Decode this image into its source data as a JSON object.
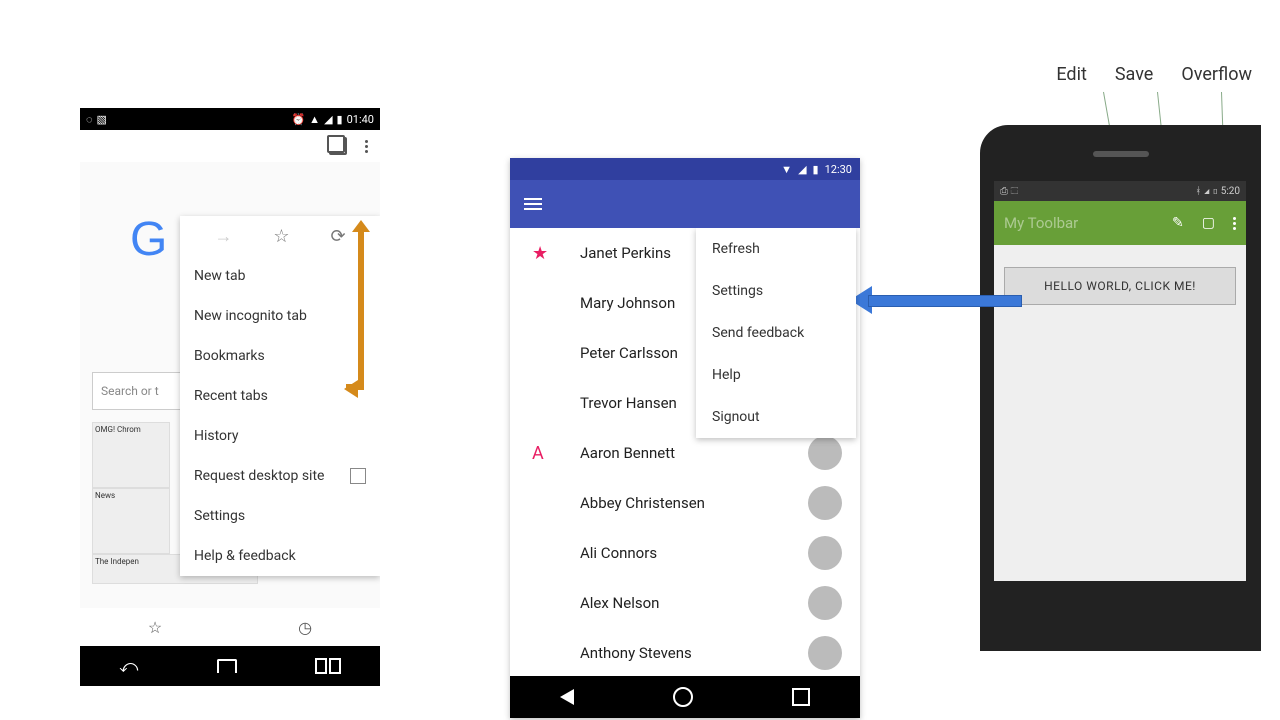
{
  "phone1": {
    "status_time": "01:40",
    "search_placeholder": "Search or t",
    "thumbs": [
      "OMG! Chrom",
      "News",
      "The Indepen"
    ],
    "menu": {
      "icons": [
        "→",
        "☆",
        "⟳"
      ],
      "items": [
        "New tab",
        "New incognito tab",
        "Bookmarks",
        "Recent tabs",
        "History",
        "Request desktop site",
        "Settings",
        "Help & feedback"
      ]
    }
  },
  "phone2": {
    "status_time": "12:30",
    "popup": [
      "Refresh",
      "Settings",
      "Send feedback",
      "Help",
      "Signout"
    ],
    "contacts": [
      {
        "badge": "★",
        "name": "Janet Perkins"
      },
      {
        "badge": "",
        "name": "Mary Johnson"
      },
      {
        "badge": "",
        "name": "Peter Carlsson"
      },
      {
        "badge": "",
        "name": "Trevor Hansen"
      },
      {
        "badge": "A",
        "name": "Aaron Bennett"
      },
      {
        "badge": "",
        "name": "Abbey Christensen"
      },
      {
        "badge": "",
        "name": "Ali Connors"
      },
      {
        "badge": "",
        "name": "Alex Nelson"
      },
      {
        "badge": "",
        "name": "Anthony Stevens"
      }
    ]
  },
  "phone3": {
    "status_time": "5:20",
    "toolbar_title": "My Toolbar",
    "button_label": "HELLO WORLD, CLICK ME!"
  },
  "top_labels": [
    "Edit",
    "Save",
    "Overflow"
  ]
}
